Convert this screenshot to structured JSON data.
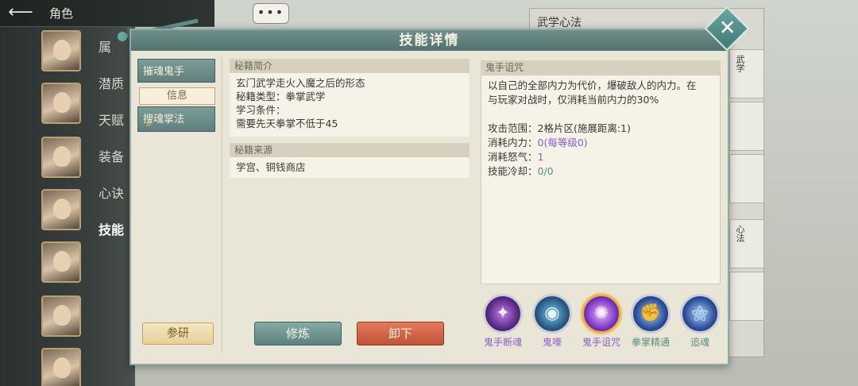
{
  "background": {
    "role_title": "角色",
    "back_icon": "arrow-left-icon",
    "chat_icon": "chat-bubble-icon",
    "chat_text": "•••",
    "side_tabs": [
      "属",
      "潜质",
      "天赋",
      "装备",
      "心诀",
      "技能"
    ],
    "right_panel_title": "武学心法",
    "right_panel_cards": [
      "武学",
      "心法"
    ]
  },
  "dialog": {
    "title": "技能详情",
    "close_icon": "close-x-icon",
    "close_glyph": "✕",
    "skill_list": [
      {
        "label": "摧魂鬼手"
      },
      {
        "label": "搜魂掌法",
        "pips": "///"
      }
    ],
    "info_tab": "信息",
    "research_btn": "参研",
    "sections": {
      "intro_title": "秘籍简介",
      "intro_lines": [
        "玄门武学走火入魔之后的形态",
        "秘籍类型：拳掌武学",
        "学习条件：",
        "需要先天拳掌不低于45"
      ],
      "source_title": "秘籍来源",
      "source_text": "学宫、铜钱商店"
    },
    "practice_btn": "修炼",
    "unequip_btn": "卸下",
    "skill": {
      "name": "鬼手诅咒",
      "desc_line1": "以自己的全部内力为代价，爆破敌人的内力。在",
      "desc_line2": "与玩家对战时，仅消耗当前内力的30%",
      "stats": [
        {
          "label": "攻击范围：",
          "value": "2格片区(施展距离:1)"
        },
        {
          "label": "消耗内力：",
          "value": "0(每等级0)"
        },
        {
          "label": "消耗怒气：",
          "value": "1"
        },
        {
          "label": "技能冷却：",
          "value": "0/0"
        }
      ]
    },
    "skill_icons": [
      {
        "name": "鬼手断魂",
        "icon": "claw-icon",
        "color": "#8a5fc7"
      },
      {
        "name": "鬼嚎",
        "icon": "eye-vortex-icon",
        "color": "#8a5fc7"
      },
      {
        "name": "鬼手诅咒",
        "icon": "curse-hand-icon",
        "color": "#8a5fc7"
      },
      {
        "name": "拳掌精通",
        "icon": "fist-mastery-icon",
        "color": "#5a8f7e"
      },
      {
        "name": "追魂",
        "icon": "spirit-chase-icon",
        "color": "#5a8f7e"
      }
    ]
  }
}
